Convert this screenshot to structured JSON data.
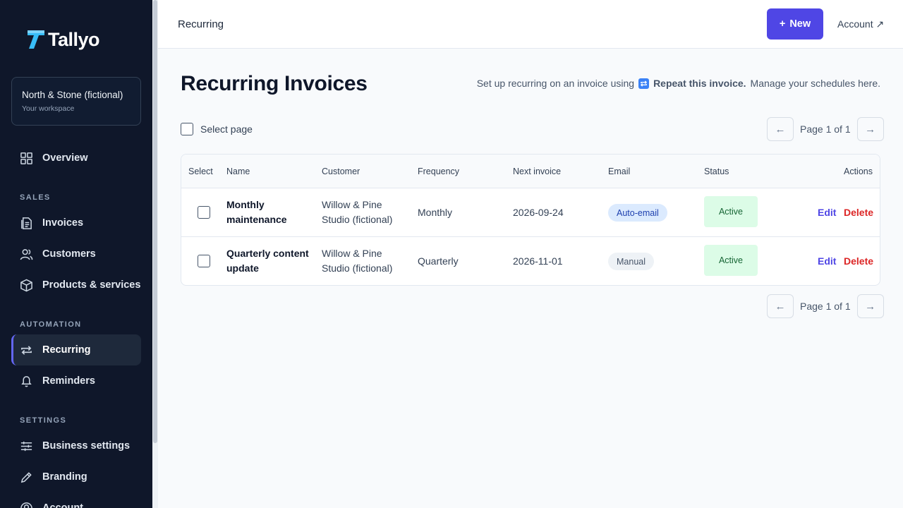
{
  "app": {
    "name": "Tallyo"
  },
  "workspace": {
    "name": "North & Stone (fictional)",
    "subtitle": "Your workspace"
  },
  "nav": {
    "overview": "Overview",
    "sections": {
      "sales": "SALES",
      "automation": "AUTOMATION",
      "settings": "SETTINGS"
    },
    "invoices": "Invoices",
    "customers": "Customers",
    "products": "Products & services",
    "recurring": "Recurring",
    "reminders": "Reminders",
    "business_settings": "Business settings",
    "branding": "Branding",
    "account": "Account"
  },
  "header": {
    "breadcrumb": "Recurring",
    "new_label": "New",
    "account_label": "Account ↗"
  },
  "page": {
    "title": "Recurring Invoices",
    "hint_prefix": "Set up recurring on an invoice using",
    "hint_strong": "Repeat this invoice.",
    "hint_suffix": "Manage your schedules here.",
    "select_page": "Select page",
    "pager_label": "Page 1 of 1",
    "prev_arrow": "←",
    "next_arrow": "→"
  },
  "table": {
    "headers": {
      "select": "Select",
      "name": "Name",
      "customer": "Customer",
      "frequency": "Frequency",
      "next": "Next invoice",
      "email": "Email",
      "status": "Status",
      "actions": "Actions"
    },
    "rows": [
      {
        "name": "Monthly maintenance",
        "customer": "Willow & Pine Studio (fictional)",
        "frequency": "Monthly",
        "next": "2026-09-24",
        "email": "Auto-email",
        "status": "Active",
        "edit": "Edit",
        "delete": "Delete"
      },
      {
        "name": "Quarterly content update",
        "customer": "Willow & Pine Studio (fictional)",
        "frequency": "Quarterly",
        "next": "2026-11-01",
        "email": "Manual",
        "status": "Active",
        "edit": "Edit",
        "delete": "Delete"
      }
    ]
  },
  "colors": {
    "primary": "#4f46e5",
    "sidebar": "#0f172a",
    "danger": "#dc2626",
    "success_bg": "#dcfce7",
    "logo": "#38bdf8"
  }
}
